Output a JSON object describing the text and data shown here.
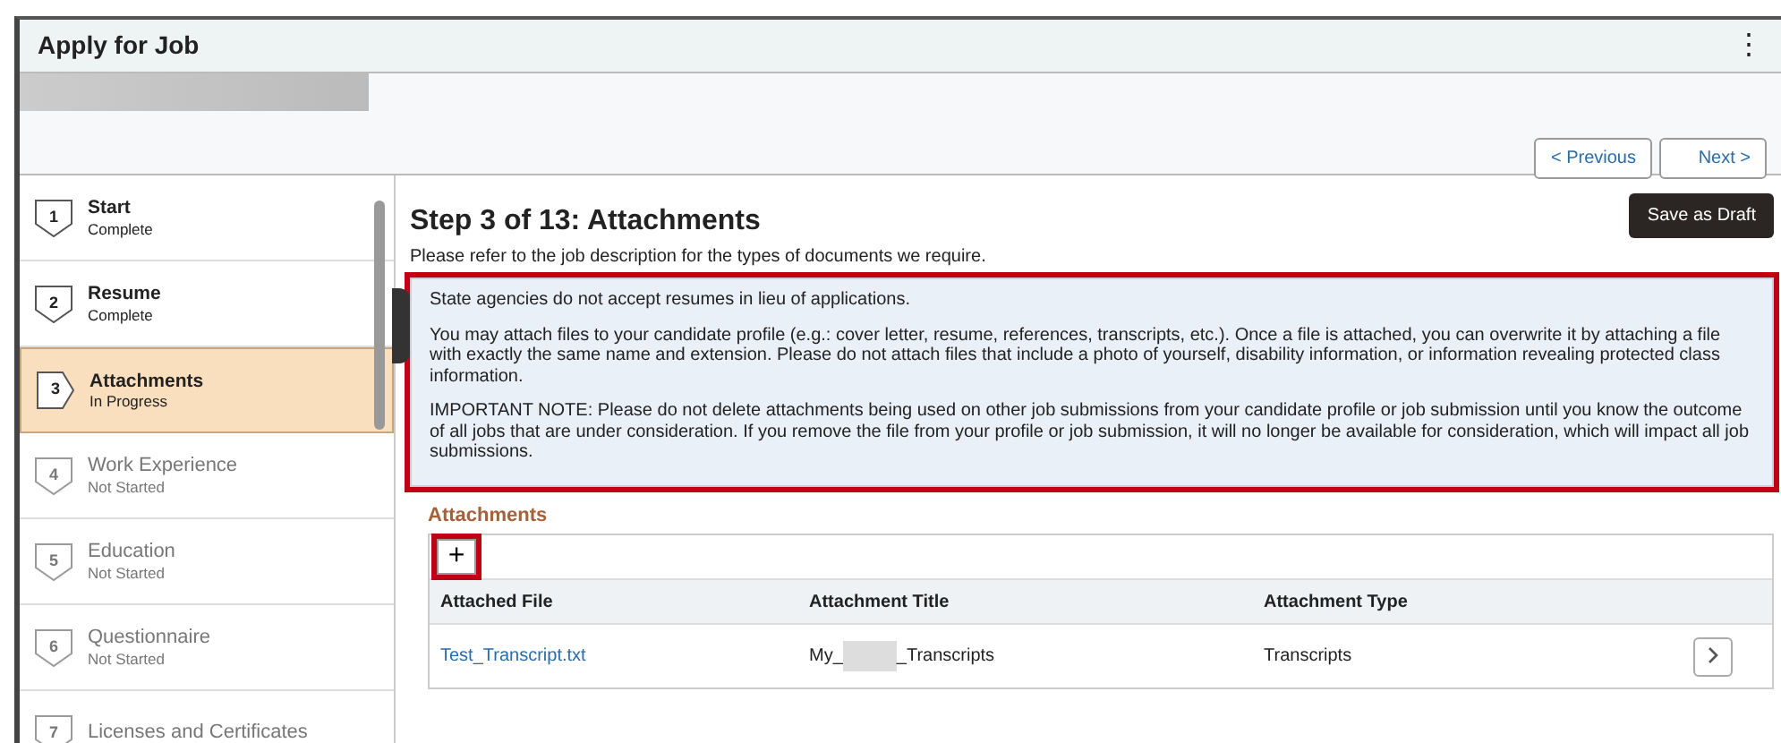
{
  "window": {
    "title": "Apply for Job",
    "menu_icon": "⋮"
  },
  "nav_buttons": [
    {
      "label": "Previous",
      "kind": "prev",
      "arrow": "<"
    },
    {
      "label": "Next",
      "kind": "next",
      "arrow": ">"
    }
  ],
  "steps": [
    {
      "number": "1",
      "label": "Start",
      "status": "Complete",
      "started": true,
      "selected": false
    },
    {
      "number": "2",
      "label": "Resume",
      "status": "Complete",
      "started": true,
      "selected": false
    },
    {
      "number": "3",
      "label": "Attachments",
      "status": "In Progress",
      "started": true,
      "selected": true
    },
    {
      "number": "4",
      "label": "Work Experience",
      "status": "Not Started",
      "started": false,
      "selected": false
    },
    {
      "number": "5",
      "label": "Education",
      "status": "Not Started",
      "started": false,
      "selected": false
    },
    {
      "number": "6",
      "label": "Questionnaire",
      "status": "Not Started",
      "started": false,
      "selected": false
    },
    {
      "number": "7",
      "label": "Licenses and Certificates",
      "started": false,
      "selected": false
    }
  ],
  "main": {
    "heading": "Step 3 of 13: Attachments",
    "save_button": "Save as Draft",
    "intro": "Please refer to the job description for the types of documents we require.",
    "notice": {
      "highlighted": true,
      "paragraphs": [
        "State agencies do not accept resumes in lieu of applications.",
        "You may attach files to your candidate profile (e.g.: cover letter, resume, references, transcripts, etc.). Once a file is attached, you can overwrite it by attaching a file with exactly the same name and extension. Please do not attach files that include a photo of yourself, disability information, or information revealing protected class information.",
        "IMPORTANT NOTE:  Please do not delete attachments being used on other job submissions from your candidate profile or job submission until you know the outcome of all jobs that are under consideration. If you remove the file from your profile or job submission, it will no longer be available for consideration, which will impact all job submissions."
      ]
    },
    "attachments": {
      "title": "Attachments",
      "add_button": {
        "label": "+",
        "highlighted": true
      },
      "columns": [
        "Attached File",
        "Attachment Title",
        "Attachment Type"
      ],
      "rows": [
        {
          "file": "Test_Transcript.txt",
          "title_parts": [
            "My_",
            "_Transcripts"
          ],
          "type": "Transcripts"
        }
      ]
    }
  }
}
